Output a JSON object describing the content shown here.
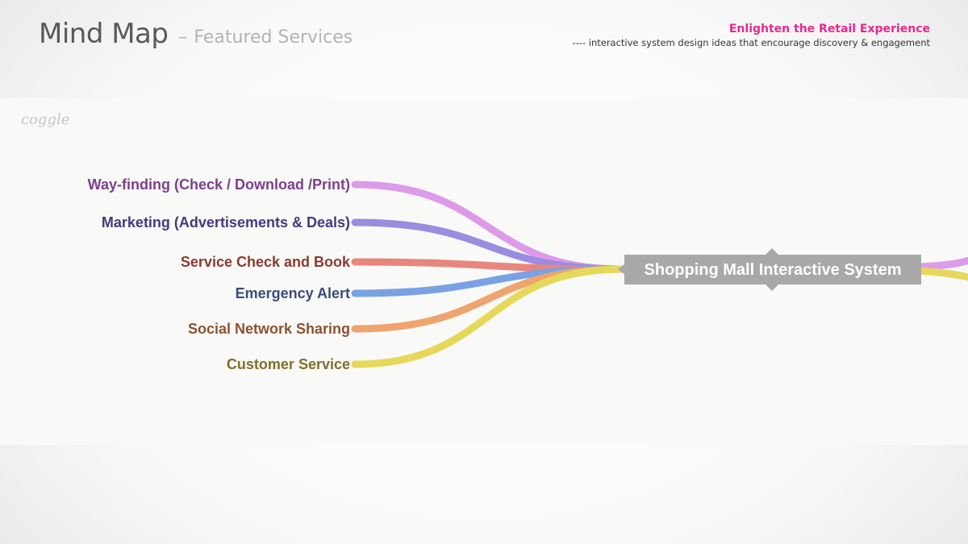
{
  "slide": {
    "title": "Mind Map",
    "separator": "–",
    "subtitle": "Featured Services",
    "tagline_head": "Enlighten the Retail Experience",
    "tagline_body": "---- interactive system design ideas that encourage discovery & engagement"
  },
  "diagram": {
    "logo": "coggle",
    "root": {
      "label": "Shopping Mall Interactive System",
      "color": "#a8a8a8"
    },
    "branches": [
      {
        "label": "Way-finding (Check / Download /Print)",
        "line_color": "#dd9ae8",
        "text_color": "#7c3f8c"
      },
      {
        "label": "Marketing (Advertisements & Deals)",
        "line_color": "#9a8cdf",
        "text_color": "#47387f"
      },
      {
        "label": "Service Check and Book",
        "line_color": "#e8867e",
        "text_color": "#8b3a2e"
      },
      {
        "label": "Emergency Alert",
        "line_color": "#7aa1e3",
        "text_color": "#3a4c7e"
      },
      {
        "label": "Social Network Sharing",
        "line_color": "#efa470",
        "text_color": "#8a5330"
      },
      {
        "label": "Customer Service",
        "line_color": "#e6d85a",
        "text_color": "#7f6f2a"
      }
    ],
    "right_stubs": [
      {
        "line_color": "#dd9ae8"
      },
      {
        "line_color": "#e6d85a"
      }
    ]
  }
}
